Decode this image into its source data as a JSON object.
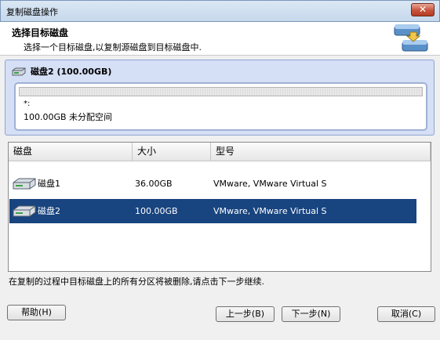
{
  "window": {
    "title": "复制磁盘操作",
    "close_label": "✕"
  },
  "header": {
    "title": "选择目标磁盘",
    "subtitle": "选择一个目标磁盘,以复制源磁盘到目标磁盘中."
  },
  "disk_panel": {
    "title": "磁盘2 (100.00GB)",
    "partition_marker": "*:",
    "partition_label": "100.00GB 未分配空间"
  },
  "table": {
    "columns": [
      "磁盘",
      "大小",
      "型号"
    ],
    "rows": [
      {
        "name": "磁盘1",
        "size": "36.00GB",
        "model": "VMware, VMware Virtual S",
        "selected": false
      },
      {
        "name": "磁盘2",
        "size": "100.00GB",
        "model": "VMware, VMware Virtual S",
        "selected": true
      }
    ]
  },
  "footer": {
    "warning": "在复制的过程中目标磁盘上的所有分区将被删除,请点击下一步继续."
  },
  "buttons": {
    "help": "帮助(H)",
    "back": "上一步(B)",
    "next": "下一步(N)",
    "cancel": "取消(C)"
  },
  "colors": {
    "selection": "#18447f",
    "panel": "#d5dff5"
  }
}
